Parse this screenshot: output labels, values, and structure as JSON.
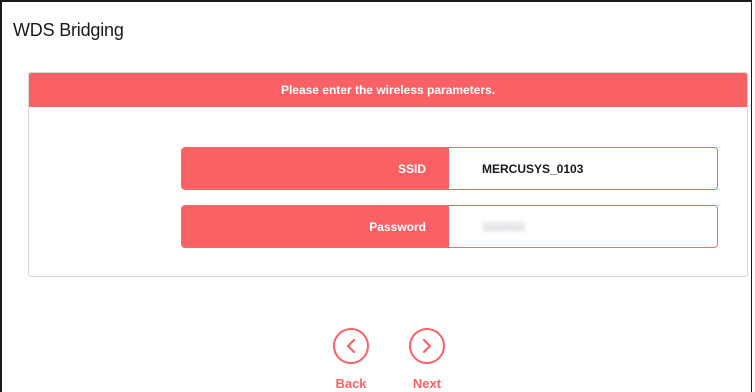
{
  "page": {
    "title": "WDS Bridging"
  },
  "panel": {
    "header": "Please enter the wireless parameters."
  },
  "fields": {
    "ssid": {
      "label": "SSID",
      "value": "MERCUSYS_0103"
    },
    "password": {
      "label": "Password",
      "value": "11111111"
    }
  },
  "navigation": {
    "back_label": "Back",
    "next_label": "Next"
  },
  "colors": {
    "accent": "#fa6165",
    "border": "#d6d6d6",
    "text": "#1a1a1a"
  },
  "icons": {
    "back": "chevron-left-icon",
    "next": "chevron-right-icon"
  }
}
